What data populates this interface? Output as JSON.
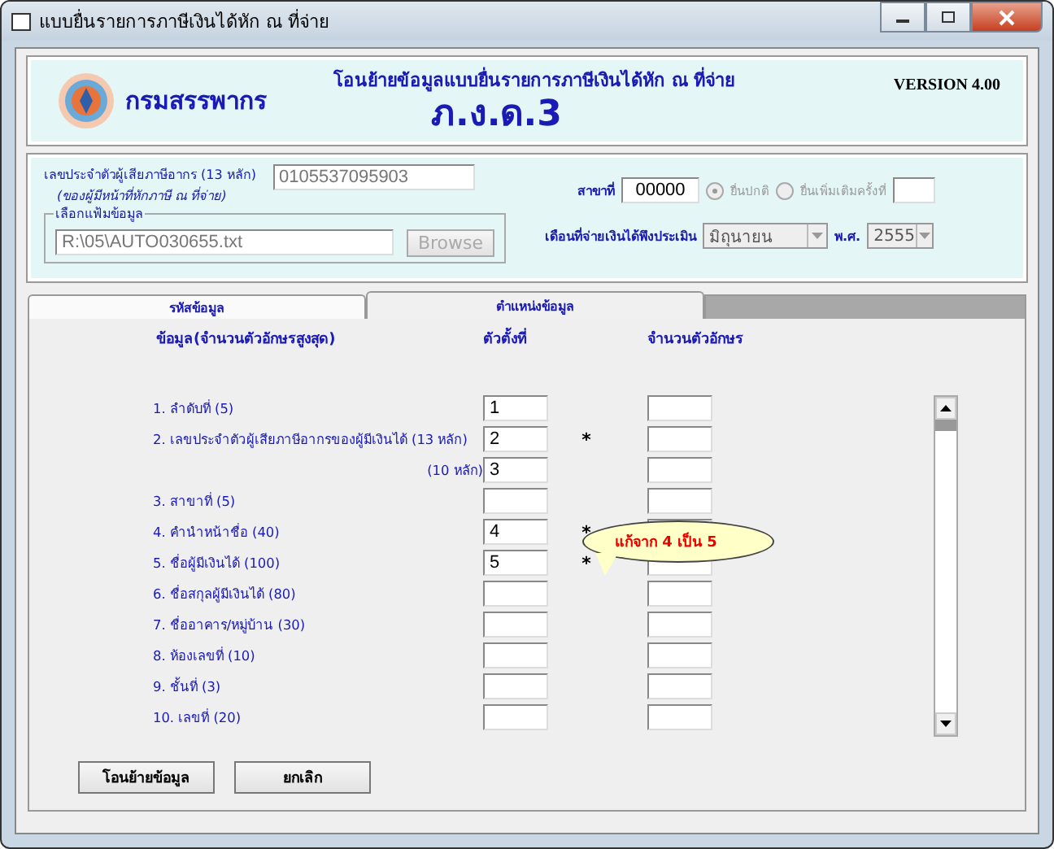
{
  "window": {
    "title": "แบบยื่นรายการภาษีเงินได้หัก ณ ที่จ่าย"
  },
  "header": {
    "agency": "กรมสรรพากร",
    "subtitle": "โอนย้ายข้อมูลแบบยื่นรายการภาษีเงินได้หัก ณ ที่จ่าย",
    "form_name": "ภ.ง.ด.3",
    "version": "VERSION 4.00"
  },
  "taxpayer": {
    "tax_id_label": "เลขประจำตัวผู้เสียภาษีอากร (13 หลัก)",
    "tax_id_note": "(ของผู้มีหน้าที่หักภาษี ณ ที่จ่าย)",
    "tax_id": "0105537095903",
    "branch_label": "สาขาที่",
    "branch": "00000",
    "filing": [
      {
        "label": "ยื่นปกติ",
        "selected": true
      },
      {
        "label": "ยื่นเพิ่มเติมครั้งที่",
        "selected": false
      }
    ],
    "file_group": "เลือกแฟ้มข้อมูล",
    "file_path": "R:\\05\\AUTO030655.txt",
    "browse": "Browse",
    "browse_disabled": true,
    "month_label": "เดือนที่จ่ายเงินได้พึงประเมิน",
    "month": "มิถุนายน",
    "year_label": "พ.ศ.",
    "year": "2555"
  },
  "tabs": [
    {
      "label": "รหัสข้อมูล",
      "selected": false
    },
    {
      "label": "ตำแหน่งข้อมูล",
      "selected": true
    }
  ],
  "columns": [
    "ข้อมูล(จำนวนตัวอักษรสูงสุด)",
    "ตัวตั้งที่",
    "จำนวนตัวอักษร"
  ],
  "rows": [
    {
      "kind": "main",
      "label": "1. ลำดับที่ (5)",
      "start": "1",
      "marked": false
    },
    {
      "kind": "main",
      "label": "2. เลขประจำตัวผู้เสียภาษีอากรของผู้มีเงินได้ (13 หลัก)",
      "start": "2",
      "marked": true
    },
    {
      "kind": "sub",
      "label": "(10 หลัก)",
      "start": "3",
      "marked": false
    },
    {
      "kind": "main",
      "label": "3. สาขาที่ (5)",
      "marked": false
    },
    {
      "kind": "main",
      "label": "4. คำนำหน้าชื่อ (40)",
      "start": "4",
      "marked": true
    },
    {
      "kind": "main",
      "label": "5. ชื่อผู้มีเงินได้ (100)",
      "start": "5",
      "marked": true
    },
    {
      "kind": "main",
      "label": "6. ชื่อสกุลผู้มีเงินได้ (80)",
      "marked": false
    },
    {
      "kind": "main",
      "label": "7. ชื่ออาคาร/หมู่บ้าน (30)",
      "marked": false
    },
    {
      "kind": "main",
      "label": "8. ห้องเลขที่ (10)",
      "marked": false
    },
    {
      "kind": "main",
      "label": "9. ชั้นที่ (3)",
      "marked": false
    },
    {
      "kind": "main",
      "label": "10. เลขที่ (20)",
      "marked": false
    }
  ],
  "mark_symbol": "*",
  "callout": "แก้จาก 4 เป็น 5",
  "buttons": [
    "โอนย้ายข้อมูล",
    "ยกเลิก"
  ]
}
